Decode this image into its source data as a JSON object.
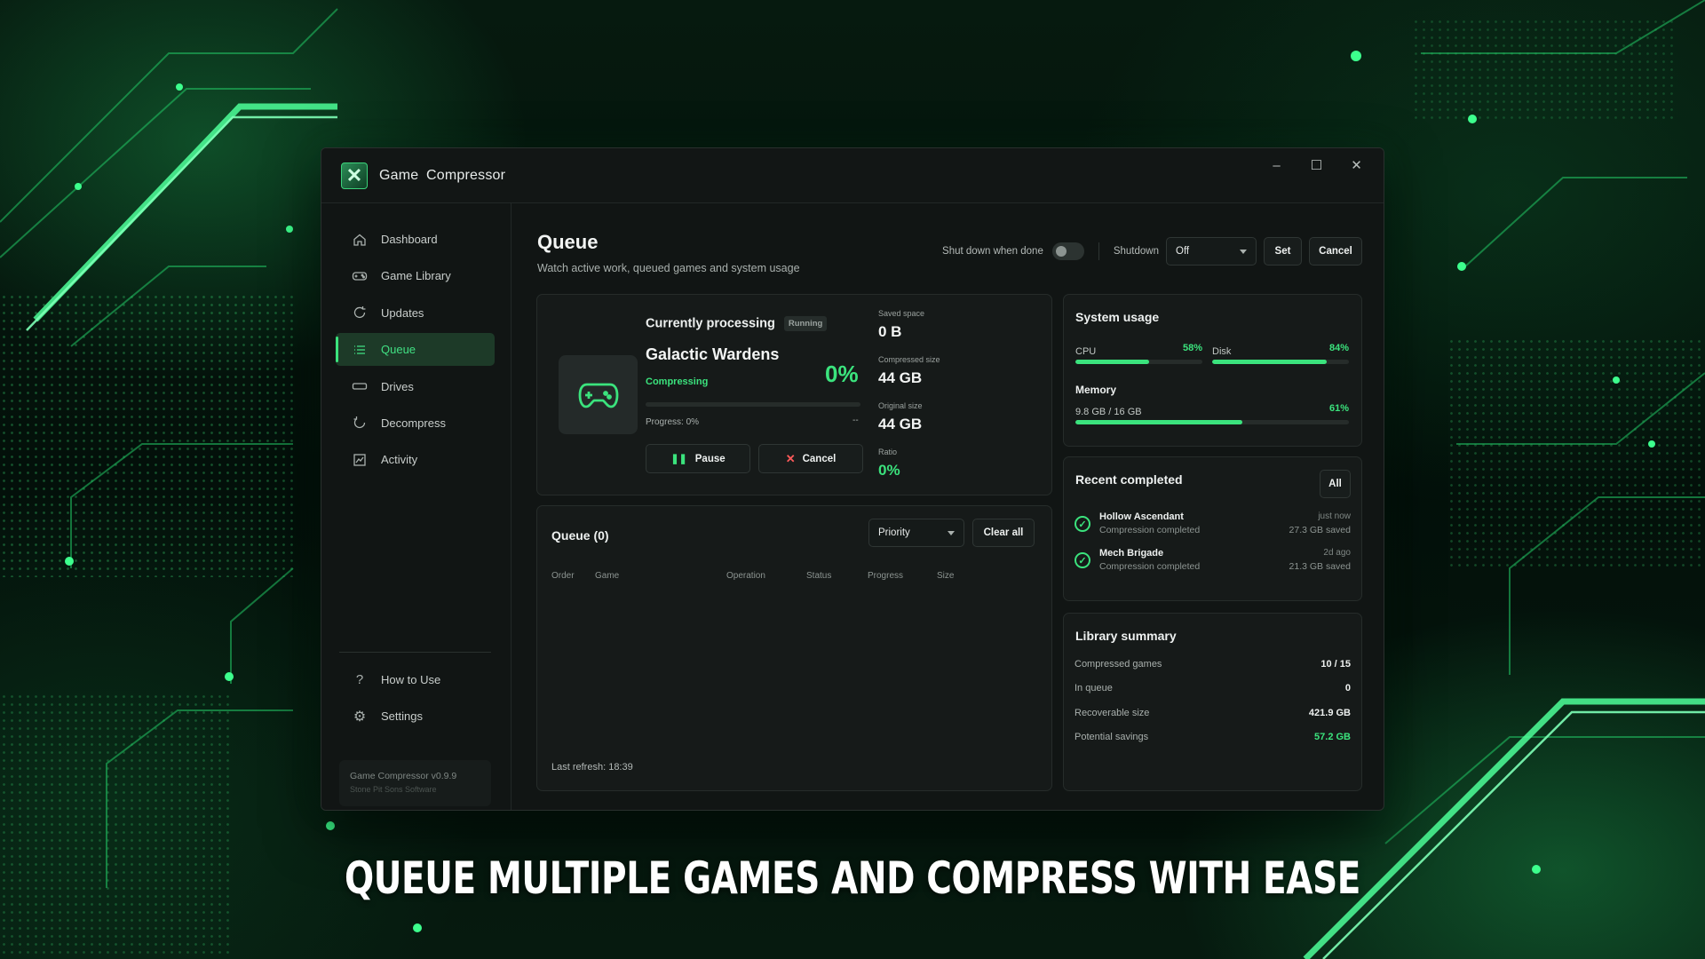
{
  "window": {
    "app_title": "Game  Compressor",
    "controls": {
      "minimize": "–",
      "maximize": "☐",
      "close": "✕"
    }
  },
  "sidebar": {
    "items": [
      {
        "label": "Dashboard",
        "icon": "home-icon"
      },
      {
        "label": "Game Library",
        "icon": "gamepad-icon"
      },
      {
        "label": "Updates",
        "icon": "refresh-icon"
      },
      {
        "label": "Queue",
        "icon": "list-icon",
        "active": true
      },
      {
        "label": "Drives",
        "icon": "drive-icon"
      },
      {
        "label": "Decompress",
        "icon": "undo-icon"
      },
      {
        "label": "Activity",
        "icon": "chart-icon"
      }
    ],
    "bottom_items": [
      {
        "label": "How to Use",
        "icon": "help-icon"
      },
      {
        "label": "Settings",
        "icon": "gear-icon"
      }
    ],
    "version": "Game Compressor v0.9.9",
    "company": "Stone Pit Sons Software"
  },
  "header": {
    "title": "Queue",
    "subtitle": "Watch active work, queued games and system usage",
    "shutdown_when_done_label": "Shut down when done",
    "shutdown_label": "Shutdown",
    "shutdown_value": "Off",
    "set_label": "Set",
    "cancel_label": "Cancel"
  },
  "current": {
    "heading": "Currently processing",
    "badge": "Running",
    "game": "Galactic Wardens",
    "status": "Compressing",
    "percent": "0%",
    "progress_fraction": 0,
    "progress_text": "Progress: 0%",
    "eta": "--",
    "pause_label": "Pause",
    "cancel_label": "Cancel",
    "stats": [
      {
        "label": "Saved space",
        "value": "0 B"
      },
      {
        "label": "Compressed size",
        "value": "44 GB"
      },
      {
        "label": "Original size",
        "value": "44 GB"
      },
      {
        "label": "Ratio",
        "value": "0%"
      }
    ]
  },
  "queue": {
    "title": "Queue (0)",
    "sort_value": "Priority",
    "clear_label": "Clear all",
    "columns": [
      "Order",
      "Game",
      "Operation",
      "Status",
      "Progress",
      "Size"
    ],
    "last_refresh": "Last refresh: 18:39"
  },
  "system_usage": {
    "title": "System usage",
    "cpu_label": "CPU",
    "cpu_pct": "58%",
    "cpu_fraction": 0.58,
    "disk_label": "Disk",
    "disk_pct": "84%",
    "disk_fraction": 0.84,
    "memory_label": "Memory",
    "memory_detail": "9.8 GB / 16 GB",
    "memory_pct": "61%",
    "memory_fraction": 0.61
  },
  "recent": {
    "title": "Recent completed",
    "filter": "All",
    "items": [
      {
        "name": "Hollow Ascendant",
        "status": "Compression completed",
        "time": "just now",
        "saved": "27.3 GB saved"
      },
      {
        "name": "Mech Brigade",
        "status": "Compression completed",
        "time": "2d ago",
        "saved": "21.3 GB saved"
      }
    ]
  },
  "library": {
    "title": "Library summary",
    "rows": [
      {
        "label": "Compressed games",
        "value": "10 / 15"
      },
      {
        "label": "In queue",
        "value": "0"
      },
      {
        "label": "Recoverable size",
        "value": "421.9 GB"
      },
      {
        "label": "Potential savings",
        "value": "57.2 GB"
      }
    ]
  },
  "colors": {
    "accent": "#3be37d",
    "window_bg": "#111514",
    "card_bg": "#161a19"
  },
  "tagline": "QUEUE MULTIPLE GAMES AND COMPRESS WITH EASE"
}
